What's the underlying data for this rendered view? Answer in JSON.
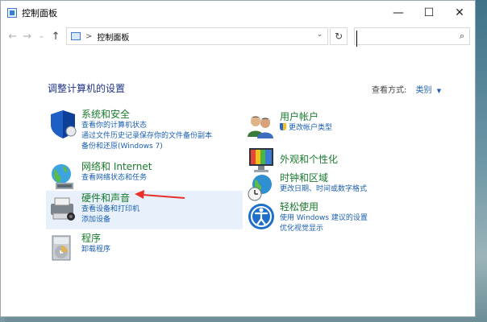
{
  "window": {
    "title": "控制面板"
  },
  "controls": {
    "minimize": "—",
    "maximize": "☐",
    "close": "✕"
  },
  "nav": {
    "back": "←",
    "forward": "→",
    "dropdown": "⌄",
    "up": "↑"
  },
  "address": {
    "separator": ">",
    "path": "控制面板",
    "dropdown": "⌄",
    "refresh": "↻"
  },
  "search": {
    "placeholder": "",
    "icon": "⌕"
  },
  "main": {
    "heading": "调整计算机的设置",
    "view_by_label": "查看方式:",
    "view_by_value": "类别",
    "view_by_caret": "▼"
  },
  "categories": {
    "system": {
      "title": "系统和安全",
      "links": [
        "查看你的计算机状态",
        "通过文件历史记录保存你的文件备份副本",
        "备份和还原(Windows 7)"
      ]
    },
    "network": {
      "title": "网络和 Internet",
      "links": [
        "查看网络状态和任务"
      ]
    },
    "hardware": {
      "title": "硬件和声音",
      "links": [
        "查看设备和打印机",
        "添加设备"
      ]
    },
    "programs": {
      "title": "程序",
      "links": [
        "卸载程序"
      ]
    },
    "accounts": {
      "title": "用户帐户",
      "links": [
        "更改帐户类型"
      ]
    },
    "appearance": {
      "title": "外观和个性化",
      "links": []
    },
    "clock": {
      "title": "时钟和区域",
      "links": [
        "更改日期、时间或数字格式"
      ]
    },
    "ease": {
      "title": "轻松使用",
      "links": [
        "使用 Windows 建议的设置",
        "优化视觉显示"
      ]
    }
  },
  "colors": {
    "category_title": "#1a7a2e",
    "link": "#1a5fb4",
    "heading": "#1e3287",
    "annotation_arrow": "#e8302a",
    "highlight": "#e8f1fb"
  }
}
